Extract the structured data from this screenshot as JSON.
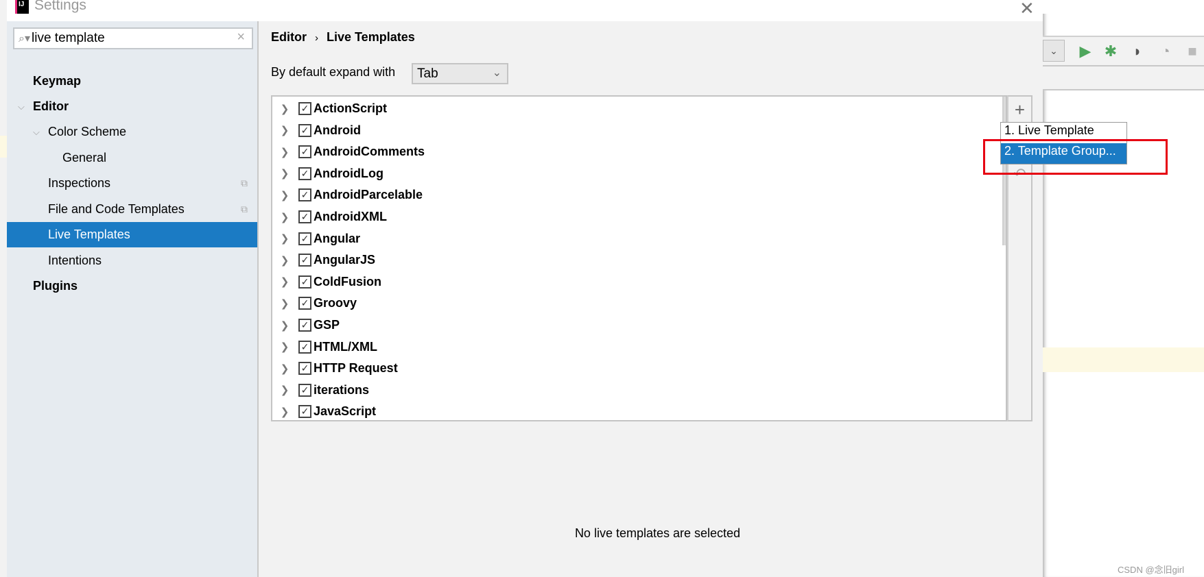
{
  "window": {
    "title": "Settings",
    "close_icon": "close-icon"
  },
  "search": {
    "value": "live template",
    "search_icon": "search-icon",
    "clear_icon": "clear-icon"
  },
  "sidebar": {
    "items": [
      {
        "label": "Keymap",
        "bold": true,
        "level": 0
      },
      {
        "label": "Editor",
        "bold": true,
        "level": 0,
        "expanded": true
      },
      {
        "label": "Color Scheme",
        "level": 1,
        "expanded": true
      },
      {
        "label": "General",
        "level": 2
      },
      {
        "label": "Inspections",
        "level": 1,
        "project_icon": true
      },
      {
        "label": "File and Code Templates",
        "level": 1,
        "project_icon": true
      },
      {
        "label": "Live Templates",
        "level": 1,
        "selected": true
      },
      {
        "label": "Intentions",
        "level": 1
      },
      {
        "label": "Plugins",
        "bold": true,
        "level": 0
      }
    ]
  },
  "breadcrumb": {
    "parent": "Editor",
    "current": "Live Templates"
  },
  "expand": {
    "label": "By default expand with",
    "value": "Tab"
  },
  "template_groups": [
    {
      "name": "ActionScript",
      "checked": true
    },
    {
      "name": "Android",
      "checked": true
    },
    {
      "name": "AndroidComments",
      "checked": true
    },
    {
      "name": "AndroidLog",
      "checked": true
    },
    {
      "name": "AndroidParcelable",
      "checked": true
    },
    {
      "name": "AndroidXML",
      "checked": true
    },
    {
      "name": "Angular",
      "checked": true
    },
    {
      "name": "AngularJS",
      "checked": true
    },
    {
      "name": "ColdFusion",
      "checked": true
    },
    {
      "name": "Groovy",
      "checked": true
    },
    {
      "name": "GSP",
      "checked": true
    },
    {
      "name": "HTML/XML",
      "checked": true
    },
    {
      "name": "HTTP Request",
      "checked": true
    },
    {
      "name": "iterations",
      "checked": true
    },
    {
      "name": "JavaScript",
      "checked": true
    }
  ],
  "add_menu": {
    "items": [
      "1. Live Template",
      "2. Template Group..."
    ],
    "selected": 1
  },
  "empty_message": "No live templates are selected",
  "watermark": "CSDN @念旧girl",
  "colors": {
    "selection": "#1b7bc4",
    "highlight_box": "#e60012",
    "sidebar_bg": "#e6ebf0",
    "run_green": "#4fa65d"
  }
}
